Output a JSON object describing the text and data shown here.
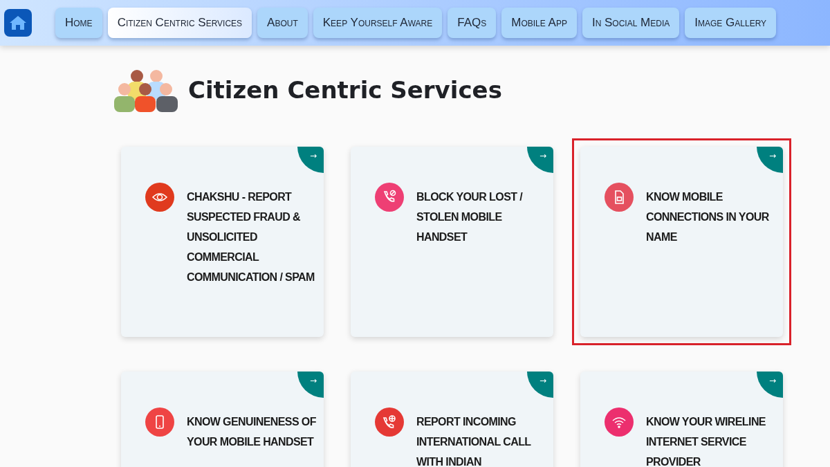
{
  "nav": {
    "items": [
      {
        "label": "Home",
        "selected": false
      },
      {
        "label": "Citizen Centric Services",
        "selected": true
      },
      {
        "label": "About",
        "selected": false
      },
      {
        "label": "Keep Yourself Aware",
        "selected": false
      },
      {
        "label": "FAQs",
        "selected": false
      },
      {
        "label": "Mobile App",
        "selected": false
      },
      {
        "label": "In Social Media",
        "selected": false
      },
      {
        "label": "Image Gallery",
        "selected": false
      }
    ]
  },
  "heading": "Citizen Centric Services",
  "cards": [
    {
      "title": "CHAKSHU - REPORT SUSPECTED FRAUD & UNSOLICITED COMMERCIAL COMMUNICATION / SPAM",
      "kind": "eye",
      "color": "#e03a1e",
      "arrow": "→",
      "highlighted": false
    },
    {
      "title": "BLOCK YOUR LOST / STOLEN MOBILE HANDSET",
      "kind": "phone-block",
      "color": "#ee3f74",
      "arrow": "→",
      "highlighted": false
    },
    {
      "title": "KNOW MOBILE CONNECTIONS IN YOUR NAME",
      "kind": "sim",
      "color": "#e5505f",
      "arrow": "→",
      "highlighted": true
    },
    {
      "title": "KNOW GENUINENESS OF YOUR MOBILE HANDSET",
      "kind": "mobile",
      "color": "#ef4444",
      "arrow": "→",
      "highlighted": false
    },
    {
      "title": "REPORT INCOMING INTERNATIONAL CALL WITH INDIAN",
      "kind": "phone-globe",
      "color": "#e53935",
      "arrow": "→",
      "highlighted": false
    },
    {
      "title": "KNOW YOUR WIRELINE INTERNET SERVICE PROVIDER",
      "kind": "wifi",
      "color": "#ec2f6e",
      "arrow": "→",
      "highlighted": false
    }
  ]
}
